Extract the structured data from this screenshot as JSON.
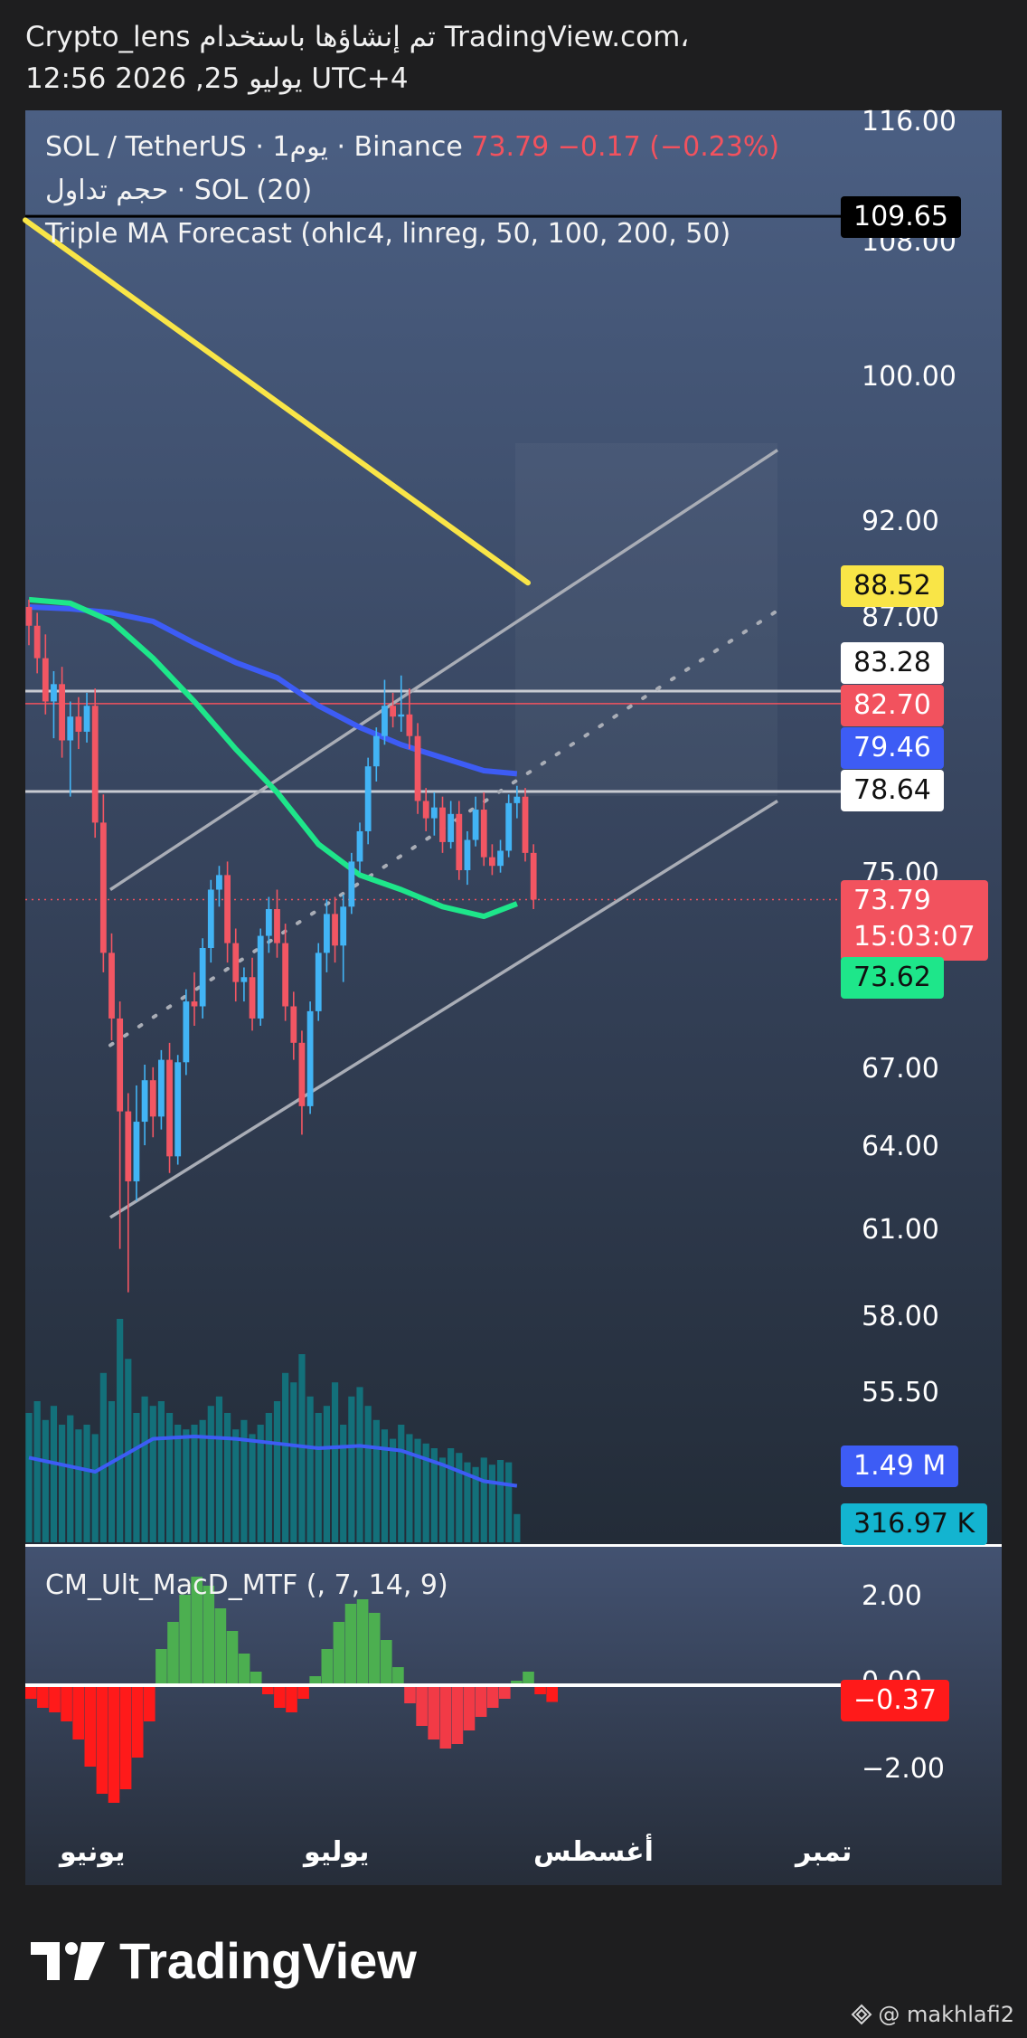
{
  "header": {
    "line1": "Crypto_lens تم إنشاؤها باستخدام TradingView.com،",
    "line2": "12:56 2026 ,25 يوليو UTC+4"
  },
  "legend": {
    "symbol": "SOL / TetherUS · 1يوم · Binance",
    "price": "73.79",
    "change": "−0.17 (−0.23%)",
    "volume": "حجم تداول · SOL (20)",
    "forecast": "Triple MA Forecast (ohlc4, linreg, 50, 100, 200, 50)",
    "macd": "CM_Ult_MacD_MTF (, 7, 14, 9)"
  },
  "price_axis": [
    "116.00",
    "108.00",
    "100.00",
    "92.00",
    "87.00",
    "75.00",
    "67.00",
    "64.00",
    "61.00",
    "58.00",
    "55.50"
  ],
  "macd_axis": [
    "2.00",
    "0.00",
    "−2.00"
  ],
  "tags": {
    "hline_top": "109.65",
    "ma200": "88.52",
    "resistance_high": "83.28",
    "red_line": "82.70",
    "ma100": "79.46",
    "resistance_low": "78.64",
    "last_price": "73.79",
    "countdown": "15:03:07",
    "ma50": "73.62",
    "vol_ma": "1.49 M",
    "vol": "316.97 K",
    "macd": "−0.37"
  },
  "time_axis": [
    "يونيو",
    "يوليو",
    "أغسطس",
    "تمبر"
  ],
  "brand": {
    "name": "TradingView",
    "credit": "@ makhlafi2"
  },
  "colors": {
    "up": "#42b4f5",
    "down": "#f25663",
    "ma200": "#f9e547",
    "ma100": "#3d5cf5",
    "ma50": "#1ee68a",
    "volume": "#13707a",
    "macd_up": "#4caf50",
    "macd_down": "#ff1a1a"
  },
  "chart_data": {
    "type": "candlestick",
    "price_range": [
      52,
      117
    ],
    "candles": [
      {
        "o": 87.2,
        "h": 87.6,
        "l": 85.4,
        "c": 86.3
      },
      {
        "o": 86.3,
        "h": 86.9,
        "l": 84.1,
        "c": 84.8
      },
      {
        "o": 84.8,
        "h": 85.9,
        "l": 82.2,
        "c": 82.8
      },
      {
        "o": 82.8,
        "h": 84.2,
        "l": 81.1,
        "c": 83.6
      },
      {
        "o": 83.6,
        "h": 84.4,
        "l": 80.2,
        "c": 81.0
      },
      {
        "o": 81.0,
        "h": 82.8,
        "l": 78.4,
        "c": 82.1
      },
      {
        "o": 82.1,
        "h": 83.0,
        "l": 80.6,
        "c": 81.4
      },
      {
        "o": 81.4,
        "h": 83.2,
        "l": 80.9,
        "c": 82.6
      },
      {
        "o": 82.6,
        "h": 83.4,
        "l": 76.5,
        "c": 77.2
      },
      {
        "o": 77.2,
        "h": 78.5,
        "l": 70.8,
        "c": 71.6
      },
      {
        "o": 71.6,
        "h": 72.4,
        "l": 68.0,
        "c": 68.9
      },
      {
        "o": 68.9,
        "h": 69.6,
        "l": 60.2,
        "c": 65.2
      },
      {
        "o": 65.2,
        "h": 65.9,
        "l": 58.7,
        "c": 62.6
      },
      {
        "o": 62.6,
        "h": 66.2,
        "l": 61.9,
        "c": 64.8
      },
      {
        "o": 64.8,
        "h": 67.0,
        "l": 63.9,
        "c": 66.4
      },
      {
        "o": 66.4,
        "h": 66.9,
        "l": 64.2,
        "c": 65.0
      },
      {
        "o": 65.0,
        "h": 67.6,
        "l": 64.5,
        "c": 67.2
      },
      {
        "o": 67.2,
        "h": 67.9,
        "l": 62.9,
        "c": 63.5
      },
      {
        "o": 63.5,
        "h": 67.4,
        "l": 63.2,
        "c": 67.1
      },
      {
        "o": 67.1,
        "h": 70.1,
        "l": 66.6,
        "c": 69.6
      },
      {
        "o": 69.6,
        "h": 70.8,
        "l": 68.6,
        "c": 69.4
      },
      {
        "o": 69.4,
        "h": 72.2,
        "l": 68.9,
        "c": 71.8
      },
      {
        "o": 71.8,
        "h": 74.6,
        "l": 71.2,
        "c": 74.2
      },
      {
        "o": 74.2,
        "h": 75.2,
        "l": 73.5,
        "c": 74.8
      },
      {
        "o": 74.8,
        "h": 75.4,
        "l": 71.2,
        "c": 72.0
      },
      {
        "o": 72.0,
        "h": 72.6,
        "l": 69.6,
        "c": 70.4
      },
      {
        "o": 70.4,
        "h": 71.0,
        "l": 69.6,
        "c": 70.6
      },
      {
        "o": 70.6,
        "h": 71.4,
        "l": 68.4,
        "c": 68.9
      },
      {
        "o": 68.9,
        "h": 72.6,
        "l": 68.6,
        "c": 72.3
      },
      {
        "o": 72.3,
        "h": 73.9,
        "l": 71.6,
        "c": 73.4
      },
      {
        "o": 73.4,
        "h": 74.2,
        "l": 71.4,
        "c": 72.0
      },
      {
        "o": 72.0,
        "h": 72.8,
        "l": 68.8,
        "c": 69.4
      },
      {
        "o": 69.4,
        "h": 70.0,
        "l": 67.2,
        "c": 67.9
      },
      {
        "o": 67.9,
        "h": 68.4,
        "l": 64.3,
        "c": 65.4
      },
      {
        "o": 65.4,
        "h": 69.6,
        "l": 65.1,
        "c": 69.2
      },
      {
        "o": 69.2,
        "h": 72.0,
        "l": 68.8,
        "c": 71.6
      },
      {
        "o": 71.6,
        "h": 73.8,
        "l": 70.8,
        "c": 73.2
      },
      {
        "o": 73.2,
        "h": 73.9,
        "l": 71.2,
        "c": 71.9
      },
      {
        "o": 71.9,
        "h": 74.0,
        "l": 70.4,
        "c": 73.5
      },
      {
        "o": 73.5,
        "h": 75.8,
        "l": 73.2,
        "c": 75.4
      },
      {
        "o": 75.4,
        "h": 77.2,
        "l": 74.9,
        "c": 76.8
      },
      {
        "o": 76.8,
        "h": 80.2,
        "l": 76.2,
        "c": 79.8
      },
      {
        "o": 79.8,
        "h": 81.6,
        "l": 79.1,
        "c": 81.2
      },
      {
        "o": 81.2,
        "h": 83.8,
        "l": 80.8,
        "c": 82.6
      },
      {
        "o": 82.6,
        "h": 83.2,
        "l": 81.6,
        "c": 82.1
      },
      {
        "o": 82.1,
        "h": 84.0,
        "l": 81.4,
        "c": 82.2
      },
      {
        "o": 82.2,
        "h": 83.4,
        "l": 80.6,
        "c": 81.2
      },
      {
        "o": 81.2,
        "h": 81.8,
        "l": 77.6,
        "c": 78.2
      },
      {
        "o": 78.2,
        "h": 78.8,
        "l": 76.8,
        "c": 77.4
      },
      {
        "o": 77.4,
        "h": 78.6,
        "l": 76.6,
        "c": 77.9
      },
      {
        "o": 77.9,
        "h": 78.4,
        "l": 75.8,
        "c": 76.3
      },
      {
        "o": 76.3,
        "h": 78.2,
        "l": 76.0,
        "c": 77.6
      },
      {
        "o": 77.6,
        "h": 78.2,
        "l": 74.6,
        "c": 75.0
      },
      {
        "o": 75.0,
        "h": 76.8,
        "l": 74.4,
        "c": 76.4
      },
      {
        "o": 76.4,
        "h": 78.4,
        "l": 76.1,
        "c": 77.8
      },
      {
        "o": 77.8,
        "h": 78.6,
        "l": 75.2,
        "c": 75.6
      },
      {
        "o": 75.6,
        "h": 76.2,
        "l": 74.8,
        "c": 75.2
      },
      {
        "o": 75.2,
        "h": 76.4,
        "l": 74.9,
        "c": 75.9
      },
      {
        "o": 75.9,
        "h": 78.5,
        "l": 75.6,
        "c": 78.1
      },
      {
        "o": 78.1,
        "h": 78.9,
        "l": 77.4,
        "c": 78.4
      },
      {
        "o": 78.4,
        "h": 78.8,
        "l": 75.4,
        "c": 75.8
      },
      {
        "o": 75.8,
        "h": 76.2,
        "l": 73.4,
        "c": 73.79
      }
    ],
    "ma200": [
      [
        0,
        109.4
      ],
      [
        560,
        88.52
      ]
    ],
    "ma100": [
      [
        0,
        87.2
      ],
      [
        5,
        87.1
      ],
      [
        10,
        86.9
      ],
      [
        15,
        86.5
      ],
      [
        20,
        85.5
      ],
      [
        25,
        84.6
      ],
      [
        30,
        83.9
      ],
      [
        35,
        82.6
      ],
      [
        40,
        81.6
      ],
      [
        45,
        80.8
      ],
      [
        50,
        80.2
      ],
      [
        55,
        79.6
      ],
      [
        59,
        79.46
      ]
    ],
    "ma50": [
      [
        0,
        87.6
      ],
      [
        5,
        87.4
      ],
      [
        10,
        86.5
      ],
      [
        15,
        84.8
      ],
      [
        20,
        82.8
      ],
      [
        25,
        80.6
      ],
      [
        30,
        78.6
      ],
      [
        35,
        76.2
      ],
      [
        40,
        74.8
      ],
      [
        45,
        74.2
      ],
      [
        50,
        73.5
      ],
      [
        55,
        73.1
      ],
      [
        59,
        73.62
      ]
    ],
    "hlines": [
      109.65,
      83.28,
      82.7,
      78.64,
      73.79
    ],
    "channel": {
      "lower": [
        [
          122,
          61.3
        ],
        [
          860,
          78.2
        ]
      ],
      "upper": [
        [
          122,
          74.2
        ],
        [
          860,
          95.8
        ]
      ],
      "mid": [
        [
          122,
          67.8
        ],
        [
          860,
          87.0
        ]
      ]
    },
    "volume_rel": [
      0.55,
      0.6,
      0.52,
      0.58,
      0.5,
      0.54,
      0.48,
      0.5,
      0.46,
      0.72,
      0.6,
      0.95,
      0.78,
      0.55,
      0.62,
      0.58,
      0.6,
      0.55,
      0.5,
      0.48,
      0.5,
      0.52,
      0.58,
      0.62,
      0.55,
      0.48,
      0.52,
      0.46,
      0.5,
      0.55,
      0.6,
      0.72,
      0.68,
      0.8,
      0.62,
      0.55,
      0.58,
      0.68,
      0.5,
      0.62,
      0.66,
      0.58,
      0.52,
      0.48,
      0.44,
      0.5,
      0.46,
      0.44,
      0.42,
      0.4,
      0.36,
      0.4,
      0.38,
      0.34,
      0.32,
      0.36,
      0.33,
      0.35,
      0.34,
      0.12
    ],
    "macd_hist": [
      -0.3,
      -0.5,
      -0.6,
      -0.8,
      -1.2,
      -1.8,
      -2.4,
      -2.6,
      -2.3,
      -1.6,
      -0.8,
      0.8,
      1.4,
      2.0,
      2.4,
      2.2,
      1.7,
      1.2,
      0.7,
      0.3,
      -0.2,
      -0.5,
      -0.6,
      -0.3,
      0.2,
      0.8,
      1.4,
      1.8,
      1.9,
      1.6,
      1.0,
      0.4,
      -0.4,
      -0.9,
      -1.2,
      -1.4,
      -1.3,
      -1.0,
      -0.7,
      -0.5,
      -0.3,
      0.1,
      0.3,
      -0.2,
      -0.37
    ]
  }
}
